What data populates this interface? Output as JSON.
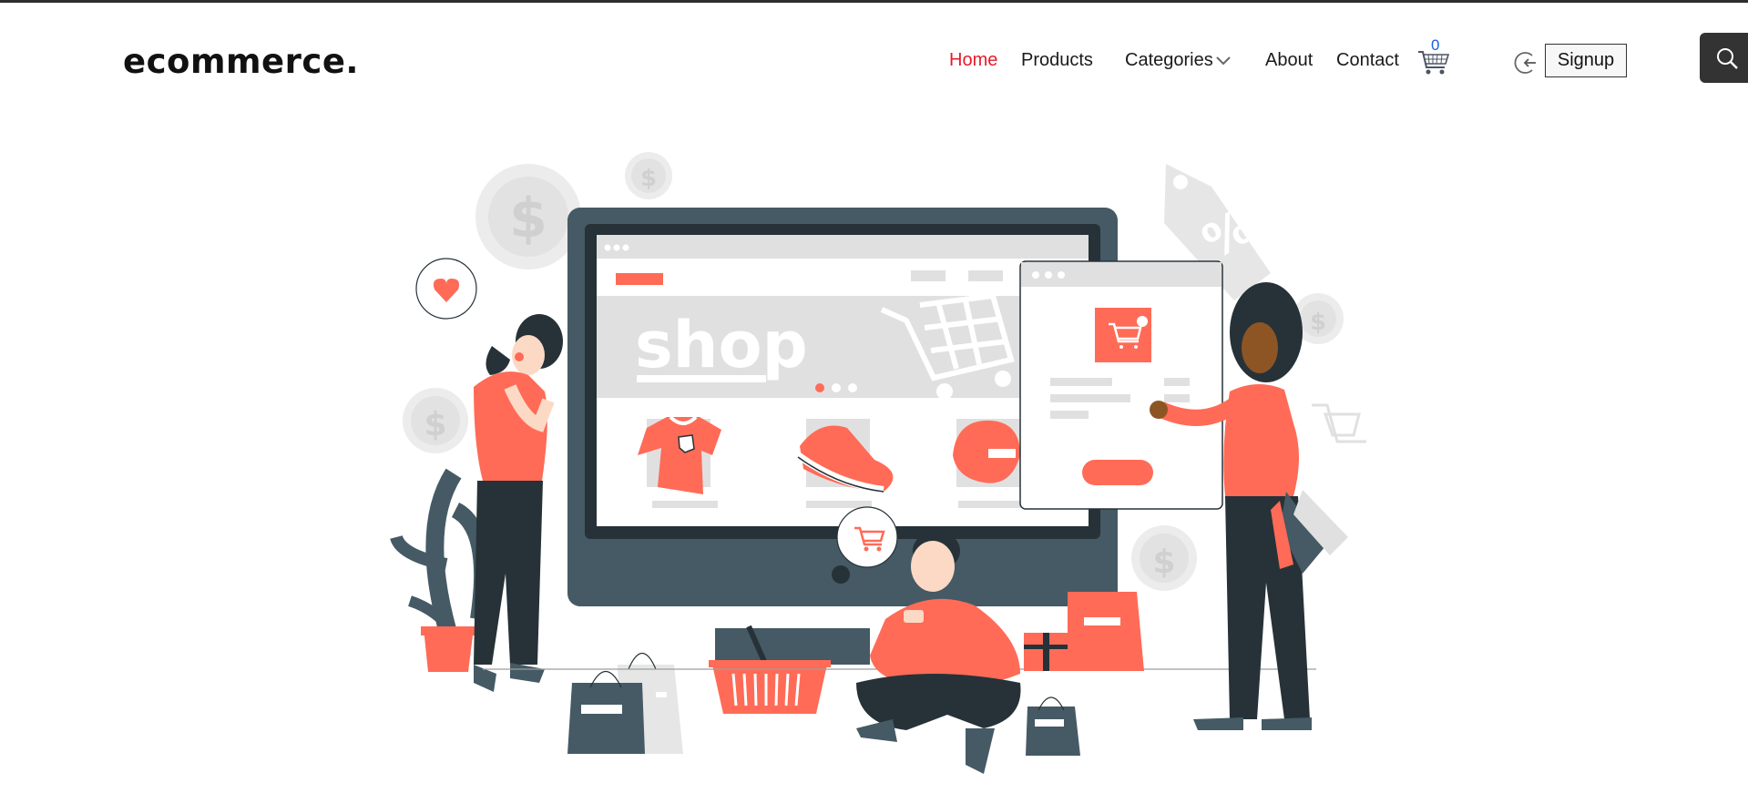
{
  "header": {
    "logo": "ecommerce.",
    "nav": {
      "home": "Home",
      "products": "Products",
      "categories": "Categories",
      "about": "About",
      "contact": "Contact"
    },
    "cart_count": "0",
    "signup_label": "Signup"
  },
  "hero": {
    "screen_word": "shop"
  },
  "colors": {
    "accent": "#e8192c",
    "illustration_primary": "#ff6b57",
    "illustration_dark": "#455a64",
    "illustration_darker": "#263238",
    "link_count": "#1a5ce6",
    "search_bg": "#333333"
  },
  "icons": {
    "cart": "shopping-cart-icon",
    "login": "login-arrow-icon",
    "search": "search-icon",
    "categories": "chevron-down-icon"
  }
}
